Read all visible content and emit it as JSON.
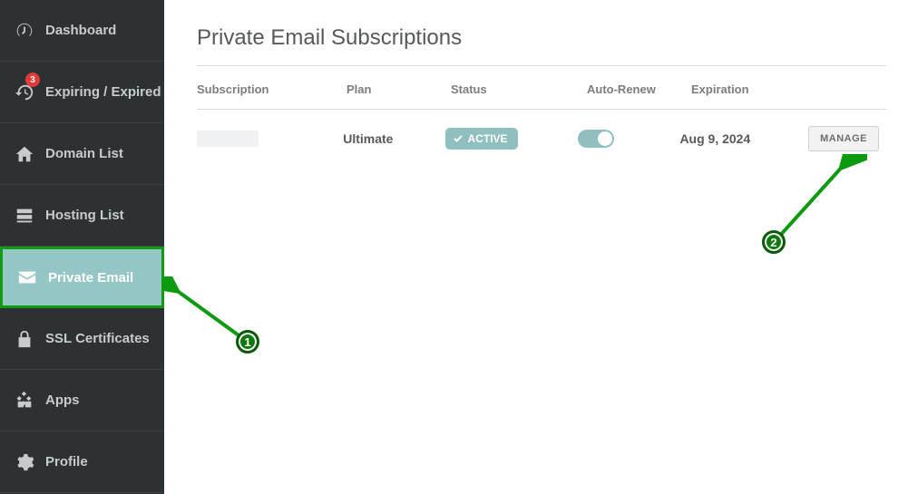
{
  "sidebar": {
    "items": [
      {
        "label": "Dashboard",
        "icon": "gauge"
      },
      {
        "label": "Expiring / Expired",
        "icon": "clock-refresh",
        "badge": "3"
      },
      {
        "label": "Domain List",
        "icon": "home"
      },
      {
        "label": "Hosting List",
        "icon": "server"
      },
      {
        "label": "Private Email",
        "icon": "mail",
        "active": true
      },
      {
        "label": "SSL Certificates",
        "icon": "lock"
      },
      {
        "label": "Apps",
        "icon": "grid"
      },
      {
        "label": "Profile",
        "icon": "gear"
      }
    ]
  },
  "page": {
    "title": "Private Email Subscriptions"
  },
  "table": {
    "headers": {
      "subscription": "Subscription",
      "plan": "Plan",
      "status": "Status",
      "autorenew": "Auto-Renew",
      "expiration": "Expiration"
    },
    "rows": [
      {
        "subscription": "",
        "plan": "Ultimate",
        "status": "ACTIVE",
        "expiration": "Aug 9, 2024",
        "action": "MANAGE"
      }
    ]
  },
  "annotations": {
    "marker1": "1",
    "marker2": "2"
  }
}
